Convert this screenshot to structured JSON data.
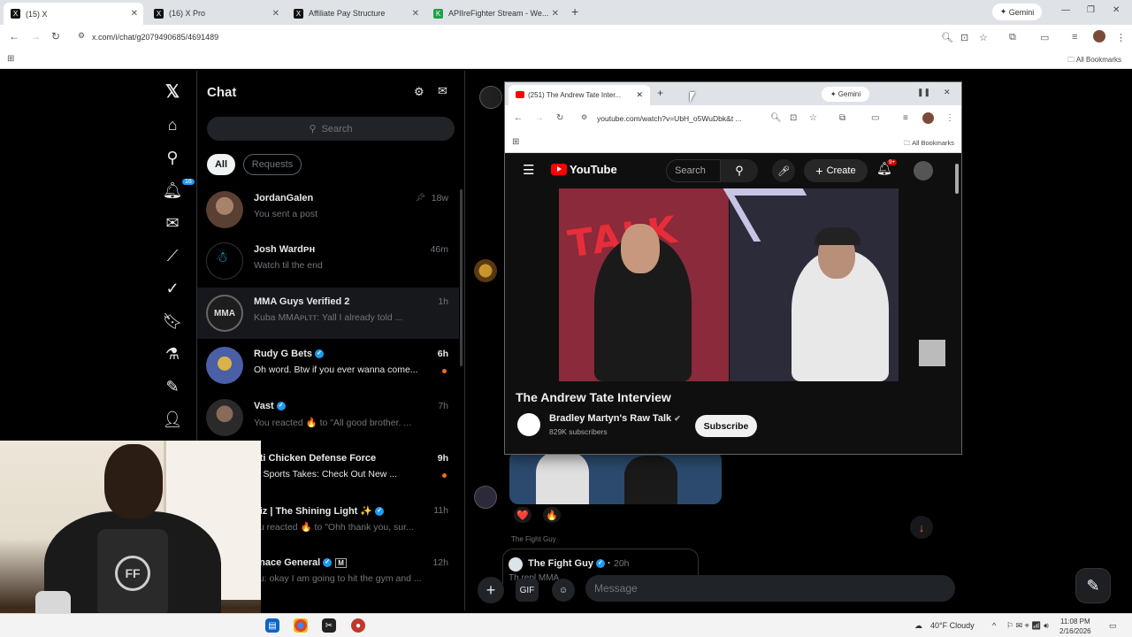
{
  "browser": {
    "tabs": [
      {
        "label": "(15) X",
        "active": true
      },
      {
        "label": "(16) X Pro",
        "active": false
      },
      {
        "label": "Affiliate Pay Structure",
        "active": false
      },
      {
        "label": "APIIreFighter Stream - We...",
        "active": false
      }
    ],
    "gemini_label": "Gemini",
    "url": "x.com/i/chat/g2079490685/4691489",
    "all_bookmarks": "All Bookmarks"
  },
  "xnav": {
    "notif_badge": "16"
  },
  "chat": {
    "title": "Chat",
    "search_placeholder": "Search",
    "filters": {
      "all": "All",
      "requests": "Requests"
    },
    "conversations": [
      {
        "name": "JordanGalen",
        "preview": "You sent a post",
        "time": "18w",
        "verified": false,
        "unread": false,
        "selected": false
      },
      {
        "name": "Josh Wardᴘʜ",
        "preview": "Watch til the end",
        "time": "46m",
        "verified": false,
        "unread": false,
        "selected": false
      },
      {
        "name": "MMA Guys Verified 2",
        "preview": "Kuba MMAᴘʟᴛᴛ: Yall I already told ...",
        "time": "1h",
        "verified": false,
        "unread": false,
        "selected": true
      },
      {
        "name": "Rudy G Bets",
        "preview": "Oh word. Btw if you ever wanna come...",
        "time": "6h",
        "verified": true,
        "unread": true,
        "selected": false
      },
      {
        "name": "Vast",
        "preview": "You reacted 🔥 to \"All good brother. ...",
        "time": "7h",
        "verified": true,
        "unread": false,
        "selected": false
      },
      {
        "name": "nti Chicken Defense Force",
        "preview": "is Sports Takes: Check Out New ...",
        "time": "9h",
        "verified": false,
        "unread": true,
        "selected": false
      },
      {
        "name": "hiz | The Shining Light ✨",
        "preview": "ou reacted 🔥 to \"Ohh thank you, sur...",
        "time": "11h",
        "verified": true,
        "unread": false,
        "selected": false
      },
      {
        "name": "enace General",
        "preview": "ou: okay I am going to hit the gym and ...",
        "time": "12h",
        "verified": true,
        "unread": false,
        "selected": false
      }
    ]
  },
  "popup": {
    "tab_label": "(251) The Andrew Tate Inter...",
    "gemini_label": "Gemini",
    "url": "youtube.com/watch?v=UbH_o5WuDbk&t ...",
    "all_bookmarks": "All Bookmarks",
    "youtube": {
      "logo_text": "YouTube",
      "search_placeholder": "Search",
      "create_label": "Create",
      "bell_badge": "9+",
      "video_title": "The Andrew Tate Interview",
      "channel_name": "Bradley Martyn's Raw Talk",
      "subscribers": "829K subscribers",
      "subscribe_label": "Subscribe",
      "thumbnail_text": "TALK"
    }
  },
  "conversation": {
    "sender_small": "The Fight Guy",
    "quote_name": "The Fight Guy",
    "quote_time": "20h",
    "quote_text": "Th   repl   MMA  ",
    "reactions": [
      "❤️",
      "🔥"
    ],
    "message_placeholder": "Message"
  },
  "taskbar": {
    "weather": "40°F Cloudy",
    "time": "11:08 PM",
    "date": "2/16/2026"
  }
}
